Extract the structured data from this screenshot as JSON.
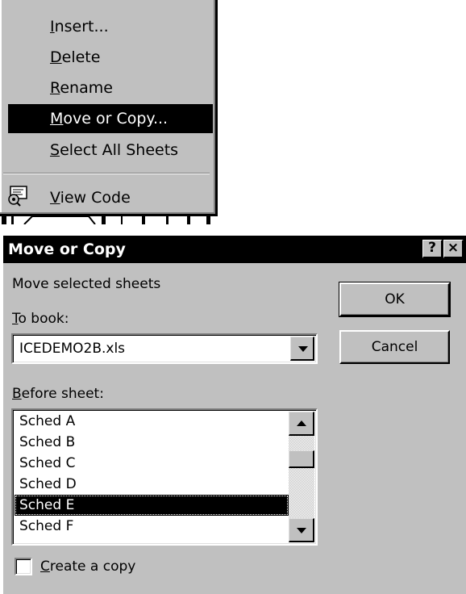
{
  "context_menu": {
    "items": [
      {
        "label": "Insert...",
        "accel": "I",
        "rest": "nsert..."
      },
      {
        "label": "Delete",
        "accel": "D",
        "rest": "elete"
      },
      {
        "label": "Rename",
        "accel": "R",
        "rest": "ename"
      },
      {
        "label": "Move or Copy...",
        "accel": "M",
        "rest": "ove or Copy...",
        "selected": true
      },
      {
        "label": "Select All Sheets",
        "accel": "S",
        "rest": "elect All Sheets"
      },
      {
        "label": "View Code",
        "accel": "V",
        "rest": "iew Code",
        "icon": "view-code-icon"
      }
    ]
  },
  "dialog": {
    "title": "Move or Copy",
    "help_button": "?",
    "close_button": "×",
    "move_label": "Move selected sheets",
    "to_book": {
      "label_accel": "T",
      "label_rest": "o book:",
      "value": "ICEDEMO2B.xls"
    },
    "before_sheet": {
      "label_accel": "B",
      "label_rest": "efore sheet:",
      "items": [
        "Sched A",
        "Sched B",
        "Sched C",
        "Sched D",
        "Sched E",
        "Sched F"
      ],
      "selected_index": 4
    },
    "create_copy": {
      "label_accel": "C",
      "label_rest": "reate a copy",
      "checked": false
    },
    "ok_label": "OK",
    "cancel_label": "Cancel"
  },
  "colors": {
    "face": "#c0c0c0",
    "highlight": "#000000",
    "highlight_text": "#ffffff"
  }
}
